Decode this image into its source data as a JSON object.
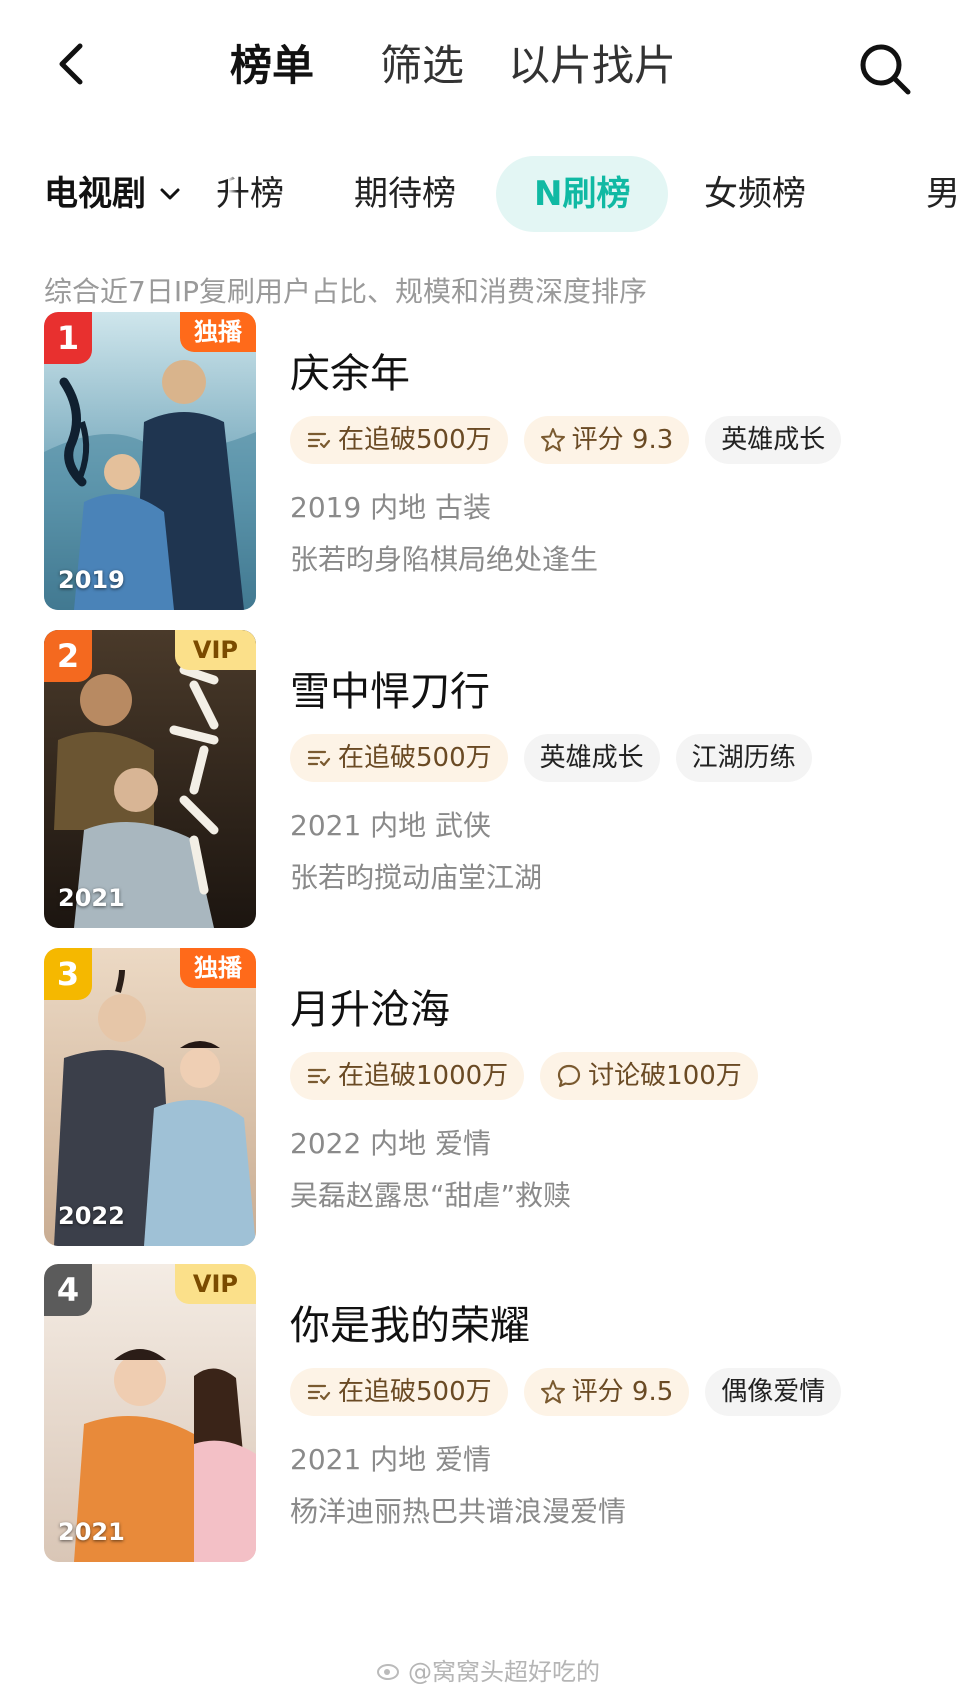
{
  "header": {
    "tabs": [
      "榜单",
      "筛选",
      "以片找片"
    ]
  },
  "category": {
    "selected": "电视剧",
    "tabs": [
      "升榜",
      "期待榜",
      "N刷榜",
      "女频榜",
      "男"
    ],
    "active_index": 2
  },
  "description": "综合近7日IP复刷用户占比、规模和消费深度排序",
  "accent_color": "#10b9a3",
  "items": [
    {
      "rank": "1",
      "rank_color": "#e8302f",
      "badge": "独播",
      "badge_type": "exclusive",
      "year_label": "2019",
      "title": "庆余年",
      "tags": [
        {
          "icon": "list-check-icon",
          "text": "在追破500万",
          "style": "warm"
        },
        {
          "icon": "star-icon",
          "text": "评分 9.3",
          "style": "warm"
        },
        {
          "icon": "",
          "text": "英雄成长",
          "style": "plain"
        }
      ],
      "meta": "2019 内地 古装",
      "subtitle": "张若昀身陷棋局绝处逢生"
    },
    {
      "rank": "2",
      "rank_color": "#f4691f",
      "badge": "VIP",
      "badge_type": "vip",
      "year_label": "2021",
      "title": "雪中悍刀行",
      "tags": [
        {
          "icon": "list-check-icon",
          "text": "在追破500万",
          "style": "warm"
        },
        {
          "icon": "",
          "text": "英雄成长",
          "style": "plain"
        },
        {
          "icon": "",
          "text": "江湖历练",
          "style": "plain"
        }
      ],
      "meta": "2021 内地 武侠",
      "subtitle": "张若昀搅动庙堂江湖"
    },
    {
      "rank": "3",
      "rank_color": "#f5b800",
      "badge": "独播",
      "badge_type": "exclusive",
      "year_label": "2022",
      "title": "月升沧海",
      "tags": [
        {
          "icon": "list-check-icon",
          "text": "在追破1000万",
          "style": "warm"
        },
        {
          "icon": "chat-bubble-icon",
          "text": "讨论破100万",
          "style": "warm"
        }
      ],
      "meta": "2022 内地 爱情",
      "subtitle": "吴磊赵露思“甜虐”救赎"
    },
    {
      "rank": "4",
      "rank_color": "#5b5b5b",
      "badge": "VIP",
      "badge_type": "vip",
      "year_label": "2021",
      "title": "你是我的荣耀",
      "tags": [
        {
          "icon": "list-check-icon",
          "text": "在追破500万",
          "style": "warm"
        },
        {
          "icon": "star-icon",
          "text": "评分 9.5",
          "style": "warm"
        },
        {
          "icon": "",
          "text": "偶像爱情",
          "style": "plain"
        }
      ],
      "meta": "2021 内地 爱情",
      "subtitle": "杨洋迪丽热巴共谱浪漫爱情"
    }
  ],
  "watermark": "@窝窝头超好吃的"
}
